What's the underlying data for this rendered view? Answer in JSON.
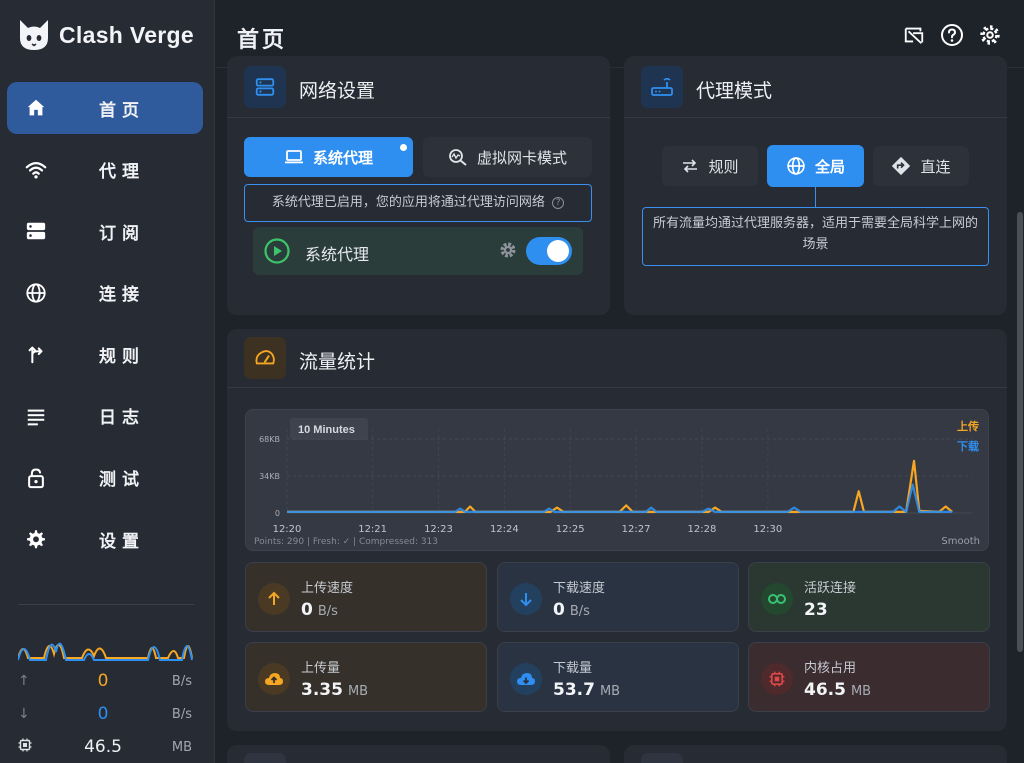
{
  "app": {
    "name": "Clash Verge"
  },
  "sidebar": {
    "items": [
      {
        "label": "首页",
        "icon": "home-icon",
        "active": true
      },
      {
        "label": "代理",
        "icon": "wifi-icon"
      },
      {
        "label": "订阅",
        "icon": "server-icon"
      },
      {
        "label": "连接",
        "icon": "globe-icon"
      },
      {
        "label": "规则",
        "icon": "fork-icon"
      },
      {
        "label": "日志",
        "icon": "list-icon"
      },
      {
        "label": "测试",
        "icon": "lock-icon"
      },
      {
        "label": "设置",
        "icon": "gear-icon"
      }
    ],
    "upload": {
      "value": "0",
      "unit": "B/s"
    },
    "download": {
      "value": "0",
      "unit": "B/s"
    },
    "memory": {
      "value": "46.5",
      "unit": "MB"
    }
  },
  "header": {
    "title": "首页"
  },
  "network": {
    "title": "网络设置",
    "tab_system": "系统代理",
    "tab_tun": "虚拟网卡模式",
    "info": "系统代理已启用，您的应用将通过代理访问网络",
    "toggle_label": "系统代理",
    "toggle_on": true
  },
  "proxy_mode": {
    "title": "代理模式",
    "rule": "规则",
    "global": "全局",
    "direct": "直连",
    "info": "所有流量均通过代理服务器，适用于需要全局科学上网的场景"
  },
  "traffic": {
    "title": "流量统计",
    "tiles": [
      {
        "label": "上传速度",
        "value": "0",
        "unit": "B/s",
        "icon": "arrow-up-icon",
        "color": "#f5a623"
      },
      {
        "label": "下载速度",
        "value": "0",
        "unit": "B/s",
        "icon": "arrow-down-icon",
        "color": "#2f8ff0"
      },
      {
        "label": "活跃连接",
        "value": "23",
        "unit": "",
        "icon": "link-icon",
        "color": "#38c172"
      },
      {
        "label": "上传量",
        "value": "3.35",
        "unit": "MB",
        "icon": "cloud-upload-icon",
        "color": "#f5a623"
      },
      {
        "label": "下载量",
        "value": "53.7",
        "unit": "MB",
        "icon": "cloud-download-icon",
        "color": "#2f8ff0"
      },
      {
        "label": "内核占用",
        "value": "46.5",
        "unit": "MB",
        "icon": "cpu-icon",
        "color": "#e04848"
      }
    ]
  },
  "colors": {
    "accent": "#2f8ff0",
    "upload": "#f5a623",
    "download": "#2f8ff0"
  },
  "chart_data": {
    "type": "line",
    "title": "10 Minutes",
    "footer_left": "Points: 290 | Fresh: ✓ | Compressed: 313",
    "footer_right": "Smooth",
    "yticks": [
      "68KB",
      "34KB",
      "0"
    ],
    "ylim": [
      0,
      68
    ],
    "y_unit": "KB",
    "xlim": [
      0,
      10.4
    ],
    "x_ticks": [
      {
        "x": 0,
        "label": "12:20"
      },
      {
        "x": 1.3,
        "label": "12:21"
      },
      {
        "x": 2.3,
        "label": "12:23"
      },
      {
        "x": 3.3,
        "label": "12:24"
      },
      {
        "x": 4.3,
        "label": "12:25"
      },
      {
        "x": 5.3,
        "label": "12:27"
      },
      {
        "x": 6.3,
        "label": "12:28"
      },
      {
        "x": 7.3,
        "label": "12:30"
      }
    ],
    "legend": [
      "上传",
      "下载"
    ],
    "series": [
      {
        "name": "上传",
        "color": "#f5a623",
        "points": [
          [
            0,
            1
          ],
          [
            2.2,
            1
          ],
          [
            2.7,
            1
          ],
          [
            2.78,
            6
          ],
          [
            2.86,
            1
          ],
          [
            4.0,
            1
          ],
          [
            4.1,
            5
          ],
          [
            4.2,
            1
          ],
          [
            5.05,
            1
          ],
          [
            5.15,
            7
          ],
          [
            5.25,
            1
          ],
          [
            6.2,
            1
          ],
          [
            6.4,
            1
          ],
          [
            6.5,
            5
          ],
          [
            6.6,
            1
          ],
          [
            8.35,
            1
          ],
          [
            8.6,
            1
          ],
          [
            8.68,
            20
          ],
          [
            8.76,
            1
          ],
          [
            9.4,
            1
          ],
          [
            9.52,
            48
          ],
          [
            9.6,
            2
          ],
          [
            9.9,
            1
          ],
          [
            10.0,
            6
          ],
          [
            10.1,
            1
          ]
        ]
      },
      {
        "name": "下载",
        "color": "#2f8ff0",
        "points": [
          [
            0,
            1
          ],
          [
            2.55,
            1
          ],
          [
            2.63,
            4
          ],
          [
            2.71,
            1
          ],
          [
            3.9,
            1
          ],
          [
            3.98,
            4
          ],
          [
            4.06,
            1
          ],
          [
            5.45,
            1
          ],
          [
            5.53,
            5
          ],
          [
            5.61,
            1
          ],
          [
            6.3,
            1
          ],
          [
            6.4,
            4
          ],
          [
            6.5,
            1
          ],
          [
            7.6,
            1
          ],
          [
            7.7,
            5
          ],
          [
            7.8,
            1
          ],
          [
            9.2,
            1
          ],
          [
            9.3,
            6
          ],
          [
            9.4,
            1
          ],
          [
            9.5,
            26
          ],
          [
            9.6,
            1
          ],
          [
            10.1,
            1
          ]
        ]
      }
    ]
  }
}
